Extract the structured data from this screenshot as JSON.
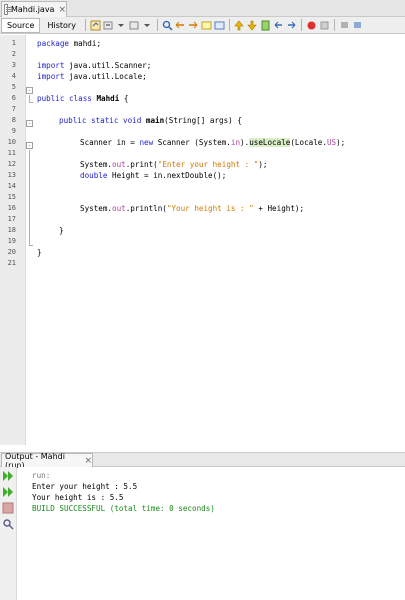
{
  "editor_tab": {
    "title": "Mahdi.java",
    "close": "×"
  },
  "toolbar": {
    "source_label": "Source",
    "history_label": "History"
  },
  "code": {
    "line_numbers": [
      "1",
      "2",
      "3",
      "4",
      "5",
      "6",
      "7",
      "8",
      "9",
      "10",
      "11",
      "12",
      "13",
      "14",
      "15",
      "16",
      "17",
      "18",
      "19",
      "20",
      "21"
    ],
    "l1_kw": "package",
    "l1_rest": " mahdi;",
    "l3_kw": "import",
    "l3_rest": " java.util.Scanner;",
    "l4_kw": "import",
    "l4_rest": " java.util.Locale;",
    "l6_kw": "public class",
    "l6_name": "Mahdi",
    "l6_rest": " {",
    "l8_kw": "public static void",
    "l8_name": "main",
    "l8_rest": "(String[] args) {",
    "l10_a": "Scanner in = ",
    "l10_kw": "new",
    "l10_b": " Scanner (System.",
    "l10_st": "in",
    "l10_c": ").",
    "l10_hl": "useLocale",
    "l10_d": "(Locale.",
    "l10_st2": "US",
    "l10_e": ");",
    "l12_a": "System.",
    "l12_st": "out",
    "l12_b": ".print(",
    "l12_str": "\"Enter your height : \"",
    "l12_c": ");",
    "l13_kw": "double",
    "l13_rest": " Height = in.nextDouble();",
    "l16_a": "System.",
    "l16_st": "out",
    "l16_b": ".println(",
    "l16_str": "\"Your height is : \"",
    "l16_c": " + Height);",
    "l18": "}",
    "l20": "}"
  },
  "output": {
    "tab_title": "Output - Mahdi (run)",
    "close": "×",
    "lines": [
      "run:",
      "Enter your height : 5.5",
      "Your height is : 5.5",
      "BUILD SUCCESSFUL (total time: 0 seconds)"
    ]
  },
  "colors": {
    "keyword": "#1f1fcf",
    "static": "#b0449b",
    "string": "#ce7b00",
    "success": "#1a8a1a"
  }
}
